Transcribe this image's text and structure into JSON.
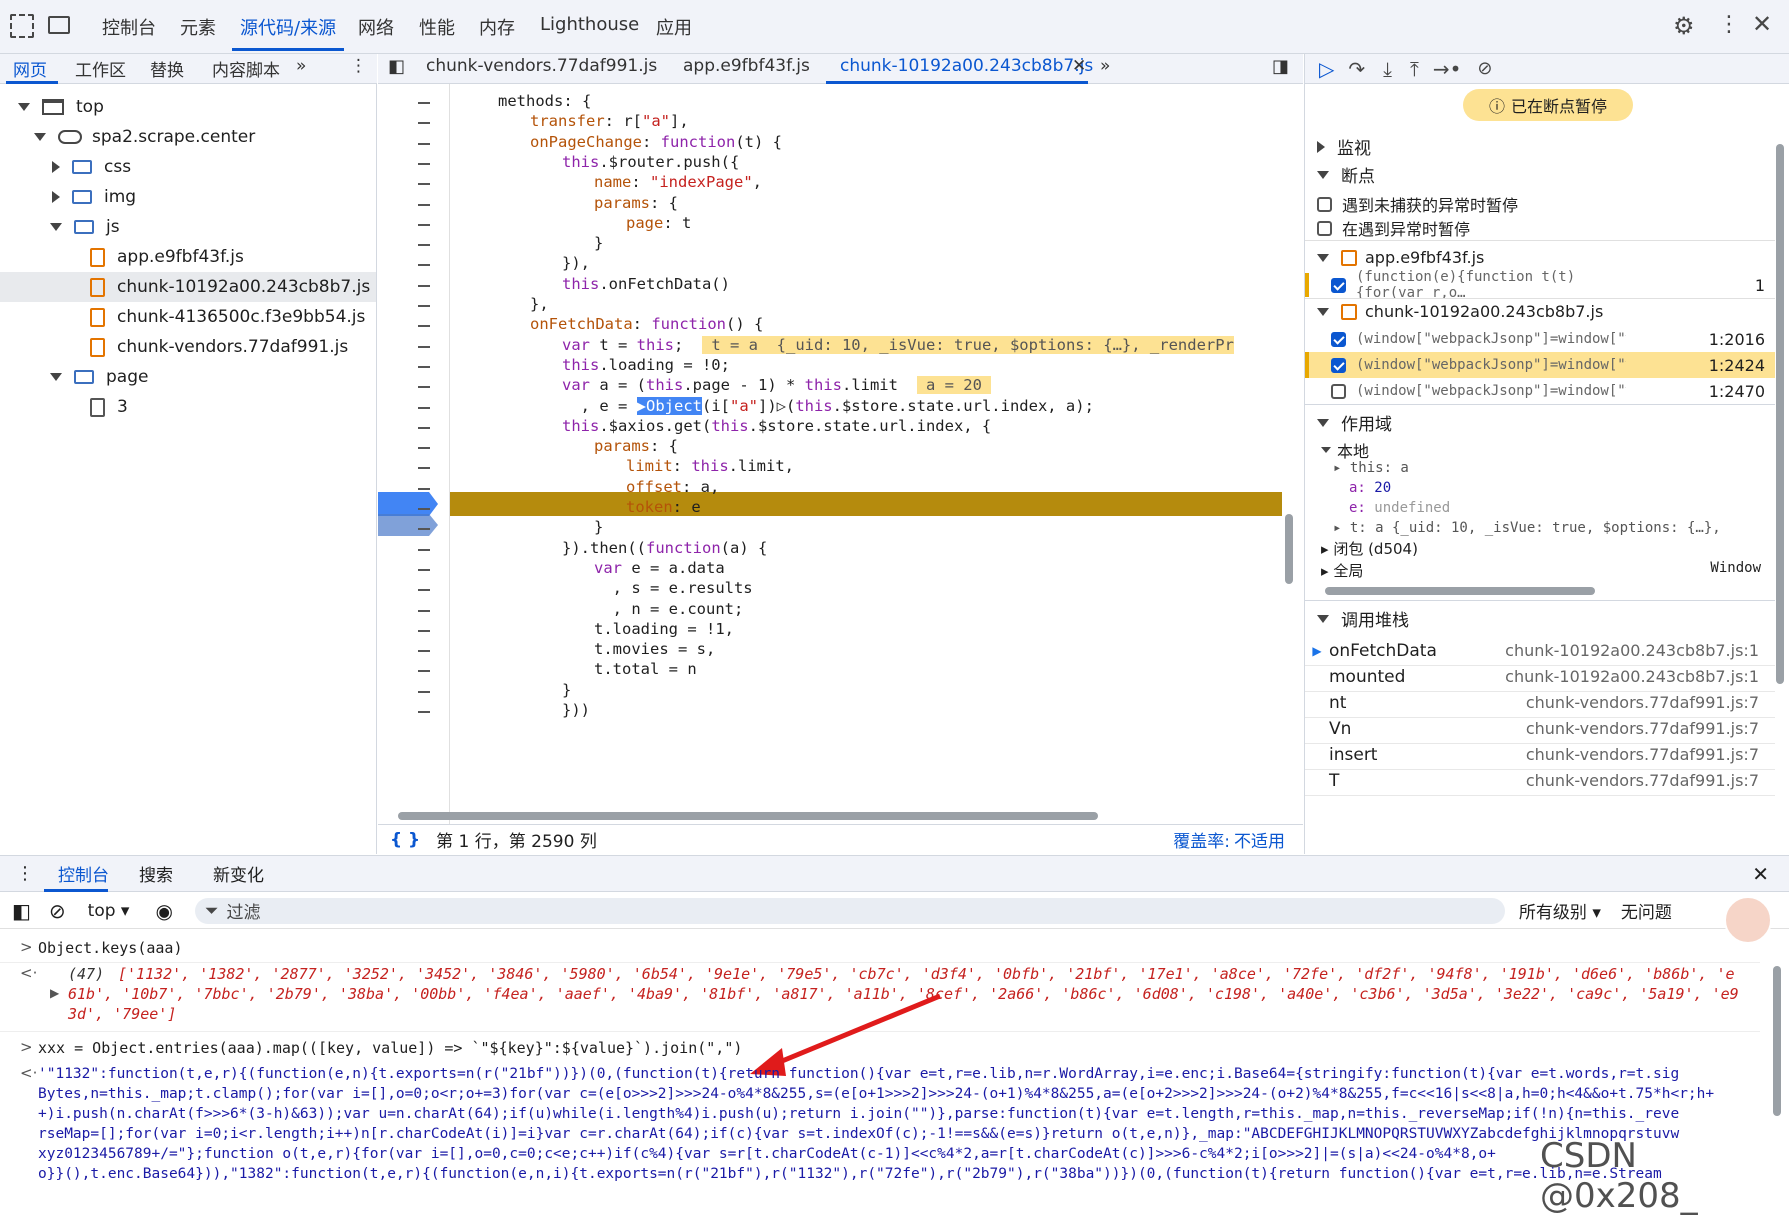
{
  "topbar": {
    "tabs": [
      "控制台",
      "元素",
      "源代码/来源",
      "网络",
      "性能",
      "内存",
      "Lighthouse",
      "应用"
    ],
    "active_tab": "源代码/来源"
  },
  "navigator": {
    "tabs": [
      "网页",
      "工作区",
      "替换",
      "内容脚本"
    ],
    "tree": {
      "top": "top",
      "domain": "spa2.scrape.center",
      "folders": [
        "css",
        "img",
        "js"
      ],
      "js_files": [
        "app.e9fbf43f.js",
        "chunk-10192a00.243cb8b7.js",
        "chunk-4136500c.f3e9bb54.js",
        "chunk-vendors.77daf991.js"
      ],
      "page_folder": "page",
      "page_file": "3"
    }
  },
  "editor": {
    "tabs": [
      "chunk-vendors.77daf991.js",
      "app.e9fbf43f.js",
      "chunk-10192a00.243cb8b7.js"
    ],
    "active_tab": "chunk-10192a00.243cb8b7.js",
    "status_position": "第 1 行，第 2590 列",
    "coverage_label": "覆盖率:",
    "coverage_value": "不适用"
  },
  "debugger": {
    "paused_badge": "已在断点暂停",
    "watch": "监视",
    "breakpoints": "断点",
    "pause_uncaught": "遇到未捕获的异常时暂停",
    "pause_caught": "在遇到异常时暂停",
    "bp_files": [
      {
        "name": "app.e9fbf43f.js",
        "items": [
          {
            "code": "(function(e){function t(t){for(var r,o…",
            "line": "1",
            "checked": true
          }
        ]
      },
      {
        "name": "chunk-10192a00.243cb8b7.js",
        "items": [
          {
            "code": "(window[\"webpackJsonp\"]=window[\"web…",
            "line": "1:2016",
            "checked": true
          },
          {
            "code": "(window[\"webpackJsonp\"]=window[\"web…",
            "line": "1:2424",
            "checked": true
          },
          {
            "code": "(window[\"webpackJsonp\"]=window[\"web…",
            "line": "1:2470",
            "checked": false
          }
        ]
      }
    ],
    "scope_title": "作用域",
    "local": "本地",
    "scope_this": "this: a",
    "scope_a_key": "a:",
    "scope_a_val": "20",
    "scope_e_key": "e:",
    "scope_e_val": "undefined",
    "scope_t": "t: a  {_uid: 10, _isVue: true, $options: {…},",
    "closure": "闭包 (d504)",
    "global": "全局",
    "global_val": "Window",
    "callstack_title": "调用堆栈",
    "callstack": [
      {
        "fn": "onFetchData",
        "loc": "chunk-10192a00.243cb8b7.js:1"
      },
      {
        "fn": "mounted",
        "loc": "chunk-10192a00.243cb8b7.js:1"
      },
      {
        "fn": "nt",
        "loc": "chunk-vendors.77daf991.js:7"
      },
      {
        "fn": "Vn",
        "loc": "chunk-vendors.77daf991.js:7"
      },
      {
        "fn": "insert",
        "loc": "chunk-vendors.77daf991.js:7"
      },
      {
        "fn": "T",
        "loc": "chunk-vendors.77daf991.js:7"
      }
    ]
  },
  "drawer": {
    "tabs": [
      "控制台",
      "搜索",
      "新变化"
    ],
    "context": "top",
    "filter_placeholder": "过滤",
    "levels": "所有级别",
    "issues": "无问题",
    "watermark": "CSDN @0x208_"
  },
  "console": {
    "in1": "Object.keys(aaa)",
    "out1_count": "(47)",
    "out1_a": "['1132', '1382', '2877', '3252', '3452', '3846', '5980', '6b54', '9e1e', '79e5', 'cb7c', 'd3f4', '0bfb', '21bf', '17e1', 'a8ce', '72fe', 'df2f', '94f8', '191b', 'd6e6', 'b86b', 'e",
    "out1_b": "61b', '10b7', '7bbc', '2b79', '38ba', '00bb', 'f4ea', 'aaef', '4ba9', '81bf', 'a817', 'a11b', '8cef', '2a66', 'b86c', '6d08', 'c198', 'a40e', 'c3b6', '3d5a', '3e22', 'ca9c', '5a19', 'e9",
    "out1_c": "3d', '79ee']",
    "in2": "xxx = Object.entries(aaa).map(([key, value]) => `\"${key}\":${value}`).join(\",\")",
    "out2": [
      "'\"1132\":function(t,e,r){(function(e,n){t.exports=n(r(\"21bf\"))})(0,(function(t){return function(){var e=t,r=e.lib,n=r.WordArray,i=e.enc;i.Base64={stringify:function(t){var e=t.words,r=t.sig",
      "Bytes,n=this._map;t.clamp();for(var i=[],o=0;o<r;o+=3)for(var c=(e[o>>>2]>>>24-o%4*8&255,s=(e[o+1>>>2]>>>24-(o+1)%4*8&255,a=(e[o+2>>>2]>>>24-(o+2)%4*8&255,f=c<<16|s<<8|a,h=0;h<4&&o+t.75*h<r;h+",
      "+)i.push(n.charAt(f>>>6*(3-h)&63));var u=n.charAt(64);if(u)while(i.length%4)i.push(u);return i.join(\"\")},parse:function(t){var e=t.length,r=this._map,n=this._reverseMap;if(!n){n=this._reve",
      "rseMap=[];for(var i=0;i<r.length;i++)n[r.charCodeAt(i)]=i}var c=r.charAt(64);if(c){var s=t.indexOf(c);-1!==s&&(e=s)}return o(t,e,n)},_map:\"ABCDEFGHIJKLMNOPQRSTUVWXYZabcdefghijklmnopqrstuvw",
      "xyz0123456789+/=\"};function o(t,e,r){for(var i=[],o=0,c=0;c<e;c++)if(c%4){var s=r[t.charCodeAt(c-1)]<<c%4*2,a=r[t.charCodeAt(c)]>>>6-c%4*2;i[o>>>2]|=(s|a)<<24-o%4*8,o+",
      "o}}(),t.enc.Base64})),\"1382\":function(t,e,r){(function(e,n,i){t.exports=n(r(\"21bf\"),r(\"1132\"),r(\"72fe\"),r(\"2b79\"),r(\"38ba\"))})(0,(function(t){return function(){var e=t,r=e.lib,n=e.Stream"
    ]
  }
}
